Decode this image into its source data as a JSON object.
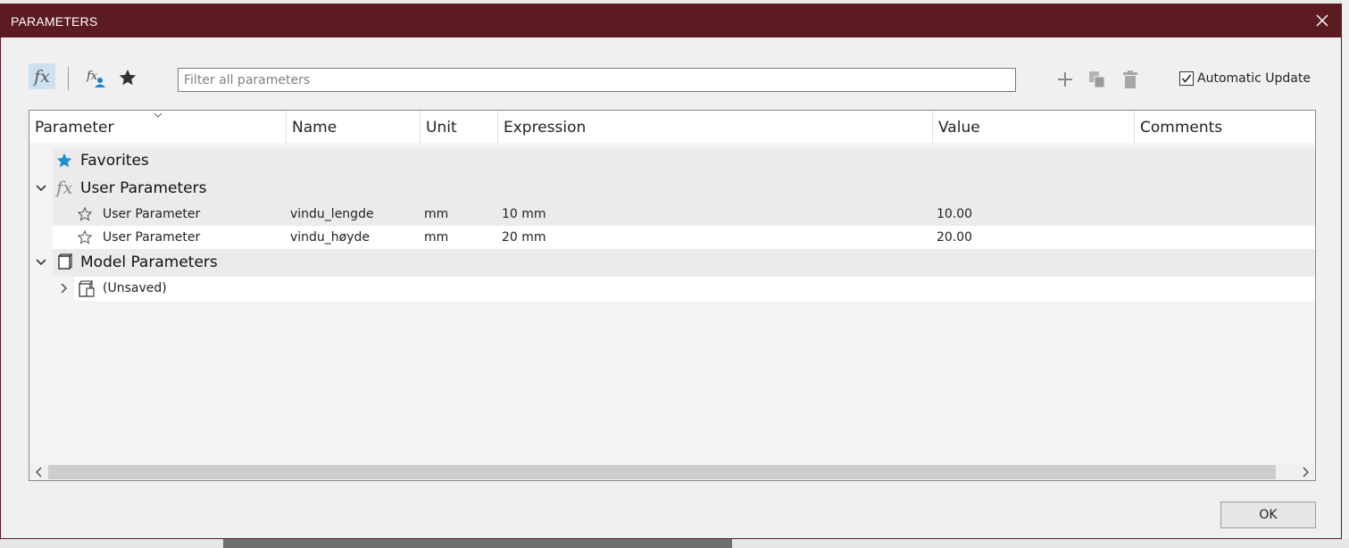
{
  "dialog": {
    "title": "PARAMETERS",
    "accent_color": "#5c1a21"
  },
  "toolbar": {
    "icons": [
      "fx-icon",
      "user-parameter-icon",
      "favorites-star-icon",
      "add-icon",
      "copy-icon",
      "delete-icon"
    ],
    "search_placeholder": "Filter all parameters",
    "search_value": "",
    "auto_update_label": "Automatic Update",
    "auto_update_checked": true
  },
  "table": {
    "columns": [
      "Parameter",
      "Name",
      "Unit",
      "Expression",
      "Value",
      "Comments"
    ],
    "groups": {
      "favorites": {
        "label": "Favorites",
        "icon": "star-icon",
        "star_color": "#1e90d6"
      },
      "user_parameters": {
        "label": "User Parameters",
        "expanded": true,
        "rows": [
          {
            "parameter": "User Parameter",
            "name": "vindu_lengde",
            "unit": "mm",
            "expression": "10 mm",
            "value": "10.00",
            "comments": ""
          },
          {
            "parameter": "User Parameter",
            "name": "vindu_høyde",
            "unit": "mm",
            "expression": "20 mm",
            "value": "20.00",
            "comments": ""
          }
        ]
      },
      "model_parameters": {
        "label": "Model Parameters",
        "expanded": true,
        "rows": [
          {
            "label": "(Unsaved)",
            "expanded": false
          }
        ]
      }
    }
  },
  "footer": {
    "ok_label": "OK"
  }
}
